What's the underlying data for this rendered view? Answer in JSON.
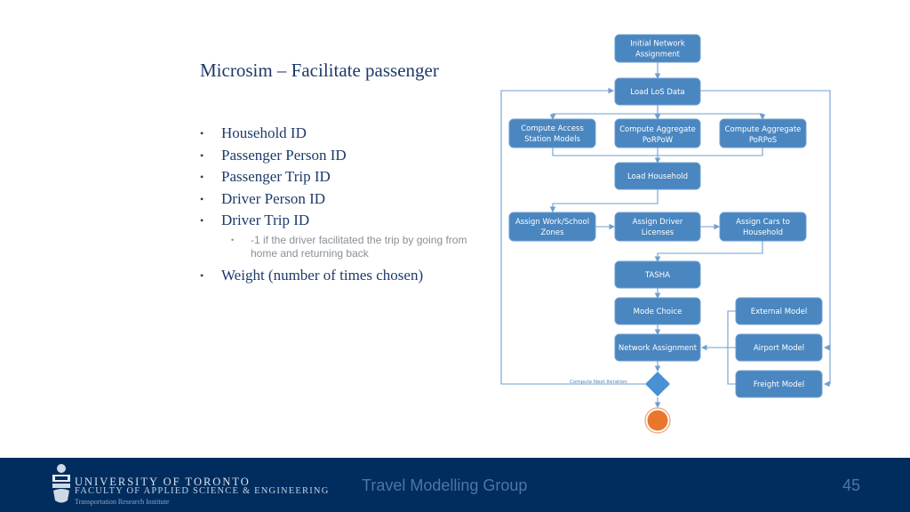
{
  "slide": {
    "title": "Microsim – Facilitate passenger",
    "bullets": [
      {
        "text": "Household ID"
      },
      {
        "text": "Passenger Person ID"
      },
      {
        "text": "Passenger Trip ID"
      },
      {
        "text": "Driver Person ID"
      },
      {
        "text": "Driver Trip ID",
        "sub": "-1 if the driver facilitated the trip by going from home and returning back"
      },
      {
        "text": "Weight (number of times chosen)"
      }
    ],
    "bullet_glyph": "•",
    "sub_bullet_glyph": "•"
  },
  "diagram": {
    "nodes": {
      "initial_network_assignment": [
        "Initial Network",
        "Assignment"
      ],
      "load_los_data": [
        "Load LoS Data"
      ],
      "compute_access_station_models": [
        "Compute Access",
        "Station Models"
      ],
      "compute_aggregate_porpow": [
        "Compute Aggregate",
        "PoRPoW"
      ],
      "compute_aggregate_porpos": [
        "Compute Aggregate",
        "PoRPoS"
      ],
      "load_household": [
        "Load Household"
      ],
      "assign_work_school_zones": [
        "Assign Work/School",
        "Zones"
      ],
      "assign_driver_licenses": [
        "Assign Driver",
        "Licenses"
      ],
      "assign_cars_to_household": [
        "Assign Cars to",
        "Household"
      ],
      "tasha": [
        "TASHA"
      ],
      "mode_choice": [
        "Mode Choice"
      ],
      "network_assignment": [
        "Network Assignment"
      ],
      "external_model": [
        "External Model"
      ],
      "airport_model": [
        "Airport Model"
      ],
      "freight_model": [
        "Freight Model"
      ]
    },
    "loop_label": "Compute Next Iteration",
    "colors": {
      "box": "#4a86c0",
      "connector": "#6f9fd0",
      "end": "#e8762d"
    }
  },
  "footer": {
    "university": "UNIVERSITY OF TORONTO",
    "faculty": "FACULTY OF APPLIED SCIENCE & ENGINEERING",
    "institute": "Transportation Research Institute",
    "group": "Travel Modelling Group",
    "page_number": "45",
    "background": "#002d5e"
  }
}
